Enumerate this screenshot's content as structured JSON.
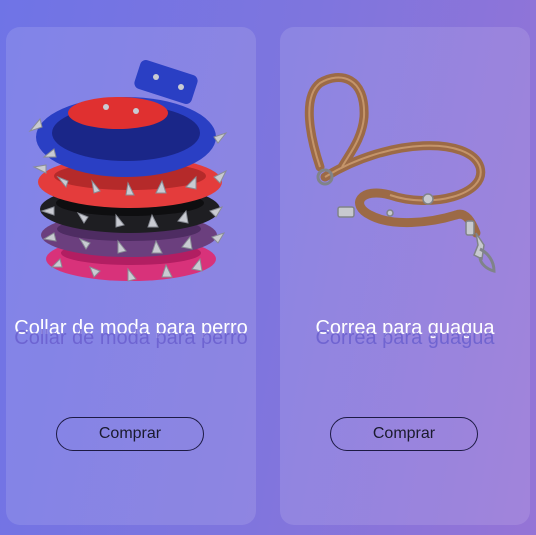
{
  "products": [
    {
      "title": "Collar de moda para perro",
      "button_label": "Comprar",
      "image_icon": "spiked-dog-collars-image"
    },
    {
      "title": "Correa para guagua",
      "button_label": "Comprar",
      "image_icon": "leather-leash-image"
    }
  ],
  "colors": {
    "bg_start": "#6f74e6",
    "bg_end": "#9574d6",
    "title": "#ffffff",
    "title_reflection": "#6a5fcf"
  }
}
